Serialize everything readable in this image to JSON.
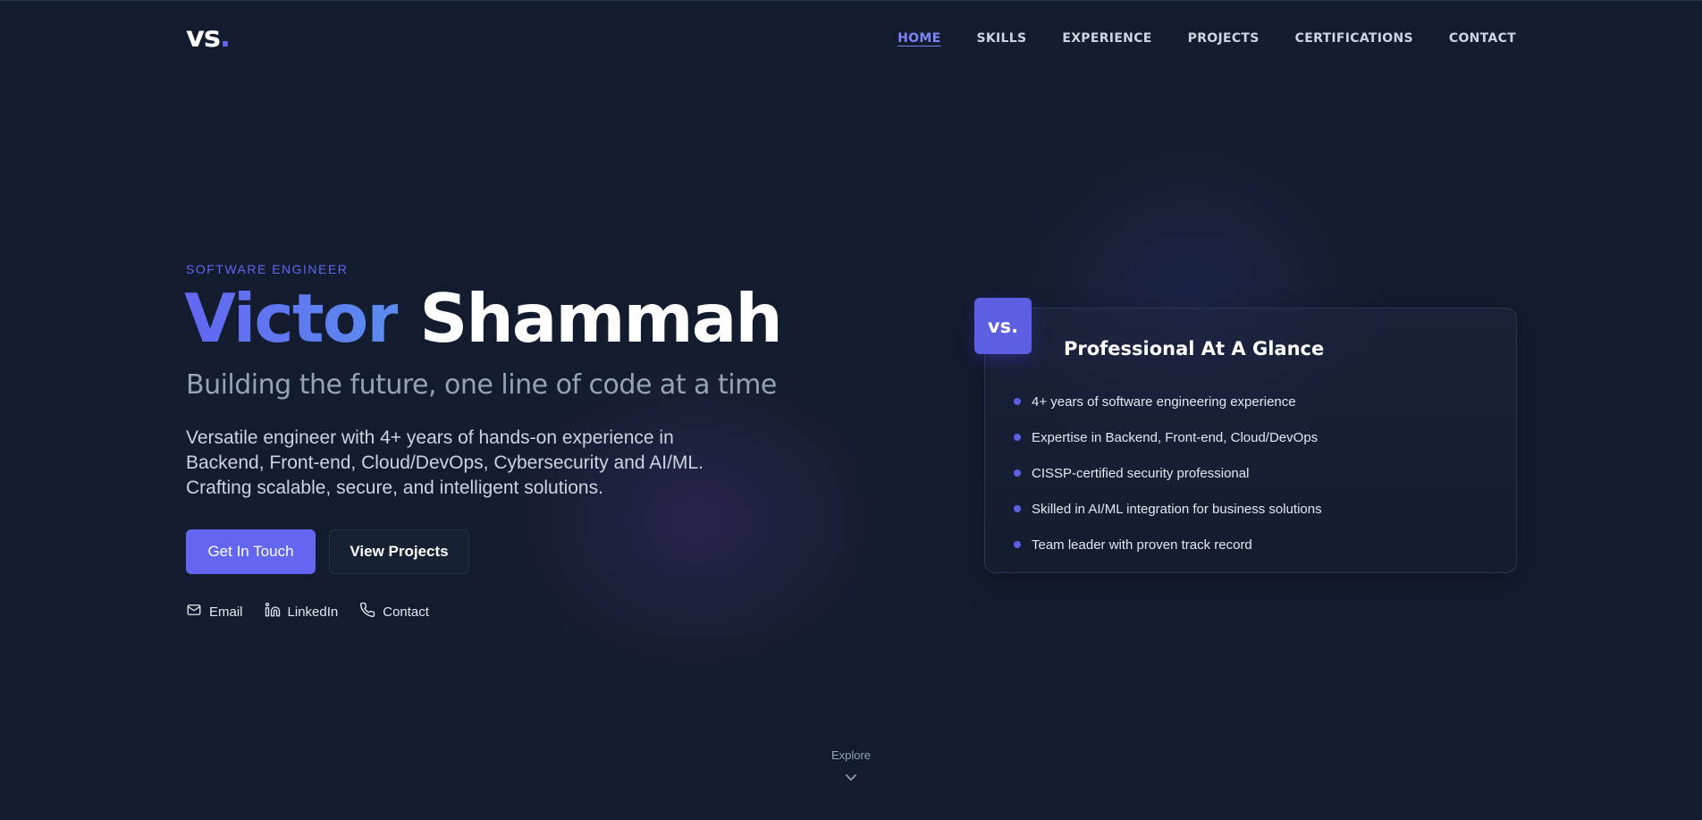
{
  "header": {
    "logo_text": "vs",
    "logo_dot": ".",
    "nav": [
      {
        "label": "HOME",
        "active": true
      },
      {
        "label": "SKILLS"
      },
      {
        "label": "EXPERIENCE"
      },
      {
        "label": "PROJECTS"
      },
      {
        "label": "CERTIFICATIONS"
      },
      {
        "label": "CONTACT"
      }
    ]
  },
  "hero": {
    "eyebrow": "SOFTWARE ENGINEER",
    "first_name": "Victor",
    "last_name": "Shammah",
    "tagline": "Building the future, one line of code at a time",
    "intro": "Versatile engineer with 4+ years of hands-on experience in Backend, Front-end, Cloud/DevOps, Cybersecurity and AI/ML. Crafting scalable, secure, and intelligent solutions.",
    "primary_button": "Get In Touch",
    "secondary_button": "View Projects",
    "social": [
      {
        "label": "Email",
        "icon": "mail-icon"
      },
      {
        "label": "LinkedIn",
        "icon": "linkedin-icon"
      },
      {
        "label": "Contact",
        "icon": "phone-icon"
      }
    ]
  },
  "card": {
    "badge": "vs.",
    "title": "Professional At A Glance",
    "items": [
      "4+ years of software engineering experience",
      "Expertise in Backend, Front-end, Cloud/DevOps",
      "CISSP-certified security professional",
      "Skilled in AI/ML integration for business solutions",
      "Team leader with proven track record"
    ]
  },
  "explore": {
    "label": "Explore",
    "icon": "chevron-down-icon"
  },
  "colors": {
    "background": "#131b2e",
    "accent": "#6366f1",
    "accent_blue": "#5b8def",
    "muted_text": "#94a3b8"
  }
}
